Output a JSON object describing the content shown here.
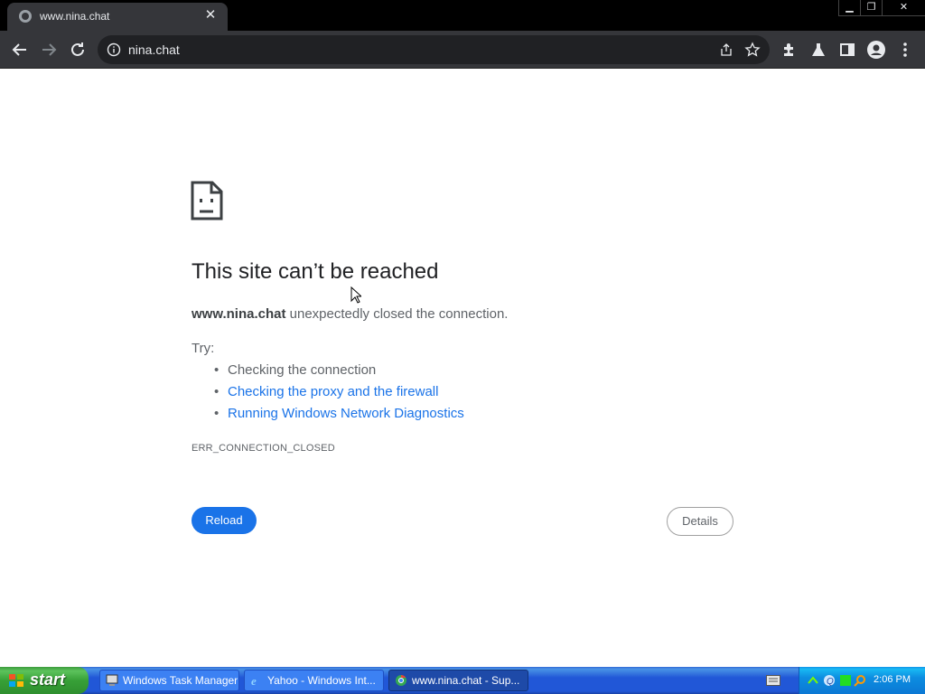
{
  "browser": {
    "tab_title": "www.nina.chat",
    "tab_close": "✕",
    "url": "nina.chat",
    "window_controls": {
      "minimize": "▁",
      "restore": "❐",
      "close": "✕"
    }
  },
  "error_page": {
    "title": "This site can’t be reached",
    "desc_host": "www.nina.chat",
    "desc_rest": " unexpectedly closed the connection.",
    "try_label": "Try:",
    "suggestions": [
      "Checking the connection",
      "Checking the proxy and the firewall",
      "Running Windows Network Diagnostics"
    ],
    "error_code": "ERR_CONNECTION_CLOSED",
    "reload_label": "Reload",
    "details_label": "Details"
  },
  "taskbar": {
    "start_label": "start",
    "tasks": [
      {
        "label": "Windows Task Manager"
      },
      {
        "label": "Yahoo - Windows Int..."
      },
      {
        "label": "www.nina.chat - Sup..."
      }
    ],
    "clock": "2:06 PM"
  },
  "colors": {
    "link": "#1a73e8",
    "reload_bg": "#1a73e8",
    "toolbar_bg": "#35363a"
  }
}
